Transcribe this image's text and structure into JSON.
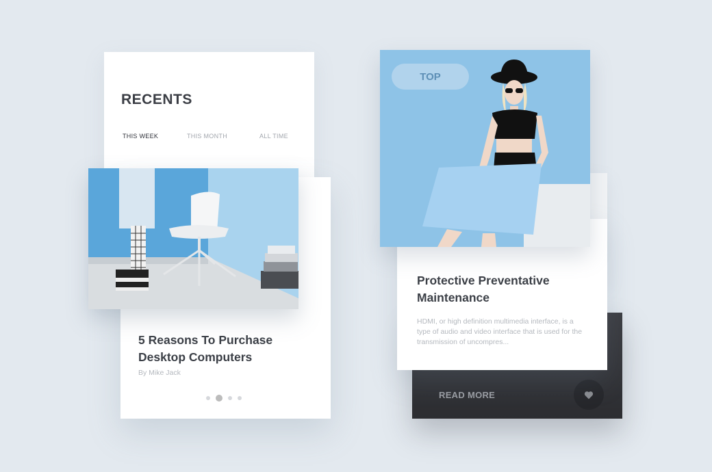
{
  "recents": {
    "title": "RECENTS",
    "tabs": [
      "THIS WEEK",
      "THIS MONTH",
      "ALL TIME"
    ],
    "active_tab": "THIS WEEK"
  },
  "left_article": {
    "title": "5 Reasons To Purchase Desktop Computers",
    "author": "By Mike Jack",
    "pagination": {
      "total": 4,
      "active": 2
    }
  },
  "right_article": {
    "badge": "TOP",
    "title": "Protective Preventative Maintenance",
    "description": "HDMI, or high definition multimedia interface, is a type of audio and video interface that is used for the transmission of uncompres...",
    "read_more": "READ MORE",
    "favorite_icon": "heart-icon"
  },
  "colors": {
    "background": "#e3e9ef",
    "photo_blue": "#8fc2e6",
    "dark_card": "#333438",
    "title_text": "#3b3f46",
    "muted_text": "#b4b8be"
  }
}
